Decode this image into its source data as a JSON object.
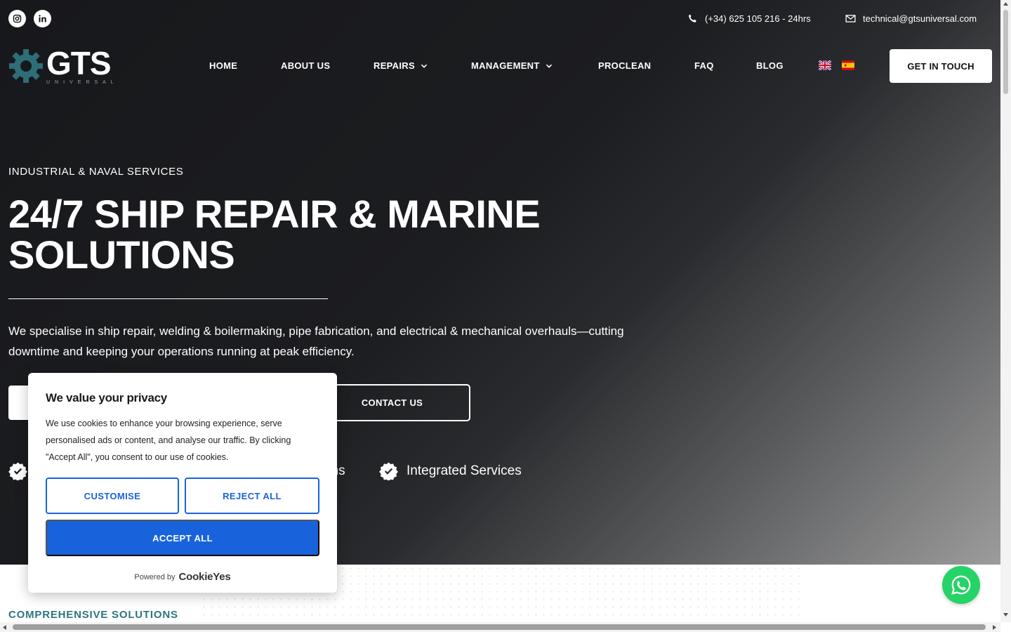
{
  "topbar": {
    "social": [
      "instagram-icon",
      "linkedin-icon"
    ],
    "phone": "(+34) 625 105 216 - 24hrs",
    "email": "technical@gtsuniversal.com"
  },
  "logo": {
    "main": "GTS",
    "sub": "UNIVERSAL"
  },
  "nav": {
    "items": [
      {
        "label": "HOME"
      },
      {
        "label": "ABOUT US"
      },
      {
        "label": "REPAIRS"
      },
      {
        "label": "MANAGEMENT"
      },
      {
        "label": "PROCLEAN"
      },
      {
        "label": "FAQ"
      },
      {
        "label": "BLOG"
      }
    ],
    "cta": "GET IN TOUCH"
  },
  "hero": {
    "eyebrow": "INDUSTRIAL & NAVAL SERVICES",
    "headline": "24/7 SHIP REPAIR & MARINE SOLUTIONS",
    "lead": "We specialise in ship repair, welding & boilermaking, pipe fabrication, and electrical & mechanical overhauls—cutting downtime and keeping your operations running at peak efficiency.",
    "contact_button": "CONTACT US",
    "features": [
      {
        "label": "ons"
      },
      {
        "label": "Integrated Services"
      }
    ]
  },
  "section": {
    "title": "COMPREHENSIVE SOLUTIONS"
  },
  "cookie": {
    "title": "We value your privacy",
    "text": "We use cookies to enhance your browsing experience, serve personalised ads or content, and analyse our traffic. By clicking \"Accept All\", you consent to our use of cookies.",
    "customise": "CUSTOMISE",
    "reject": "REJECT ALL",
    "accept": "ACCEPT ALL",
    "powered_by": "Powered by",
    "brand": "CookieYes"
  },
  "colors": {
    "accent_blue": "#1863dc",
    "teal": "#2d7480",
    "whatsapp": "#25d366"
  }
}
